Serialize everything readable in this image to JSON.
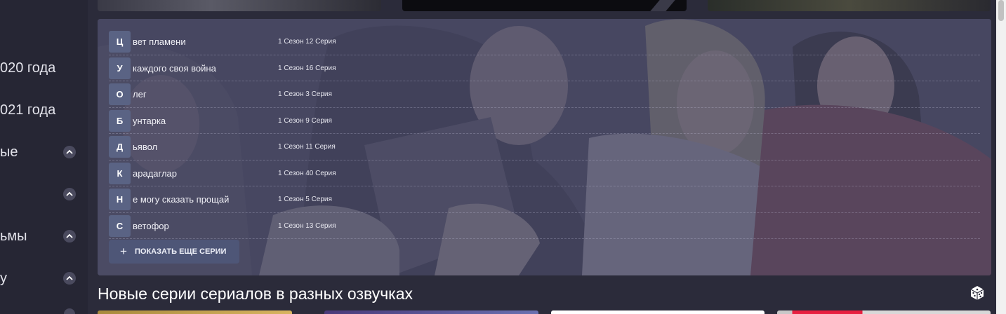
{
  "sidebar": {
    "items": [
      {
        "label": "020 года"
      },
      {
        "label": "021 года"
      },
      {
        "label": "ые"
      },
      {
        "label": ""
      },
      {
        "label": "ьмы"
      },
      {
        "label": "у"
      }
    ]
  },
  "episodes": [
    {
      "letter": "Ц",
      "title": "вет пламени",
      "episode": "1 Сезон 12 Серия"
    },
    {
      "letter": "У",
      "title": "каждого своя война",
      "episode": "1 Сезон 16 Серия"
    },
    {
      "letter": "О",
      "title": "лег",
      "episode": "1 Сезон 3 Серия"
    },
    {
      "letter": "Б",
      "title": "унтарка",
      "episode": "1 Сезон 9 Серия"
    },
    {
      "letter": "Д",
      "title": "ьявол",
      "episode": "1 Сезон 11 Серия"
    },
    {
      "letter": "К",
      "title": "арадаглар",
      "episode": "1 Сезон 40 Серия"
    },
    {
      "letter": "Н",
      "title": "е могу сказать прощай",
      "episode": "1 Сезон 5 Серия"
    },
    {
      "letter": "С",
      "title": "ветофор",
      "episode": "1 Сезон 13 Серия"
    }
  ],
  "show_more": {
    "label": "ПОКАЗАТЬ ЕЩЕ СЕРИИ",
    "icon": "plus-icon"
  },
  "section": {
    "title": "Новые серии сериалов в разных озвучках",
    "icon": "dice-icon"
  },
  "colors": {
    "page_bg": "#2b2b3a",
    "letter_badge": "#5a6384",
    "button_bg": "#4e5677"
  }
}
